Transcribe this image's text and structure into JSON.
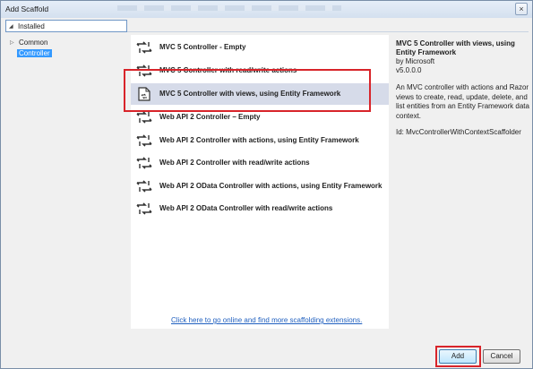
{
  "window": {
    "title": "Add Scaffold",
    "close_glyph": "×"
  },
  "installed_header": {
    "collapse_glyph": "◢",
    "label": "Installed"
  },
  "tree": {
    "items": [
      {
        "label": "Common",
        "expand_glyph": "▷",
        "selected": false
      },
      {
        "label": "Controller",
        "selected": true
      }
    ]
  },
  "scaffolds": {
    "items": [
      {
        "label": "MVC 5 Controller - Empty",
        "icon": "controller-arrows-icon"
      },
      {
        "label": "MVC 5 Controller with read/write actions",
        "icon": "controller-arrows-icon"
      },
      {
        "label": "MVC 5 Controller with views, using Entity Framework",
        "icon": "document-controller-icon",
        "selected": true
      },
      {
        "label": "Web API 2 Controller – Empty",
        "icon": "controller-arrows-icon"
      },
      {
        "label": "Web API 2 Controller with actions, using Entity Framework",
        "icon": "controller-arrows-icon"
      },
      {
        "label": "Web API 2 Controller with read/write actions",
        "icon": "controller-arrows-icon"
      },
      {
        "label": "Web API 2 OData Controller with actions, using Entity Framework",
        "icon": "controller-arrows-icon"
      },
      {
        "label": "Web API 2 OData Controller with read/write actions",
        "icon": "controller-arrows-icon"
      }
    ],
    "online_link": "Click here to go online and find more scaffolding extensions."
  },
  "details": {
    "title": "MVC 5 Controller with views, using Entity Framework",
    "author": "by Microsoft",
    "version": "v5.0.0.0",
    "description": "An MVC controller with actions and Razor views to create, read, update, delete, and list entities from an Entity Framework data context.",
    "id": "Id: MvcControllerWithContextScaffolder"
  },
  "buttons": {
    "add_label": "Add",
    "cancel_label": "Cancel"
  },
  "colors": {
    "highlight_red": "#d8242a",
    "selection_blue": "#3399ff",
    "link_blue": "#1f5fbf",
    "selected_row": "#d6dbe9"
  }
}
